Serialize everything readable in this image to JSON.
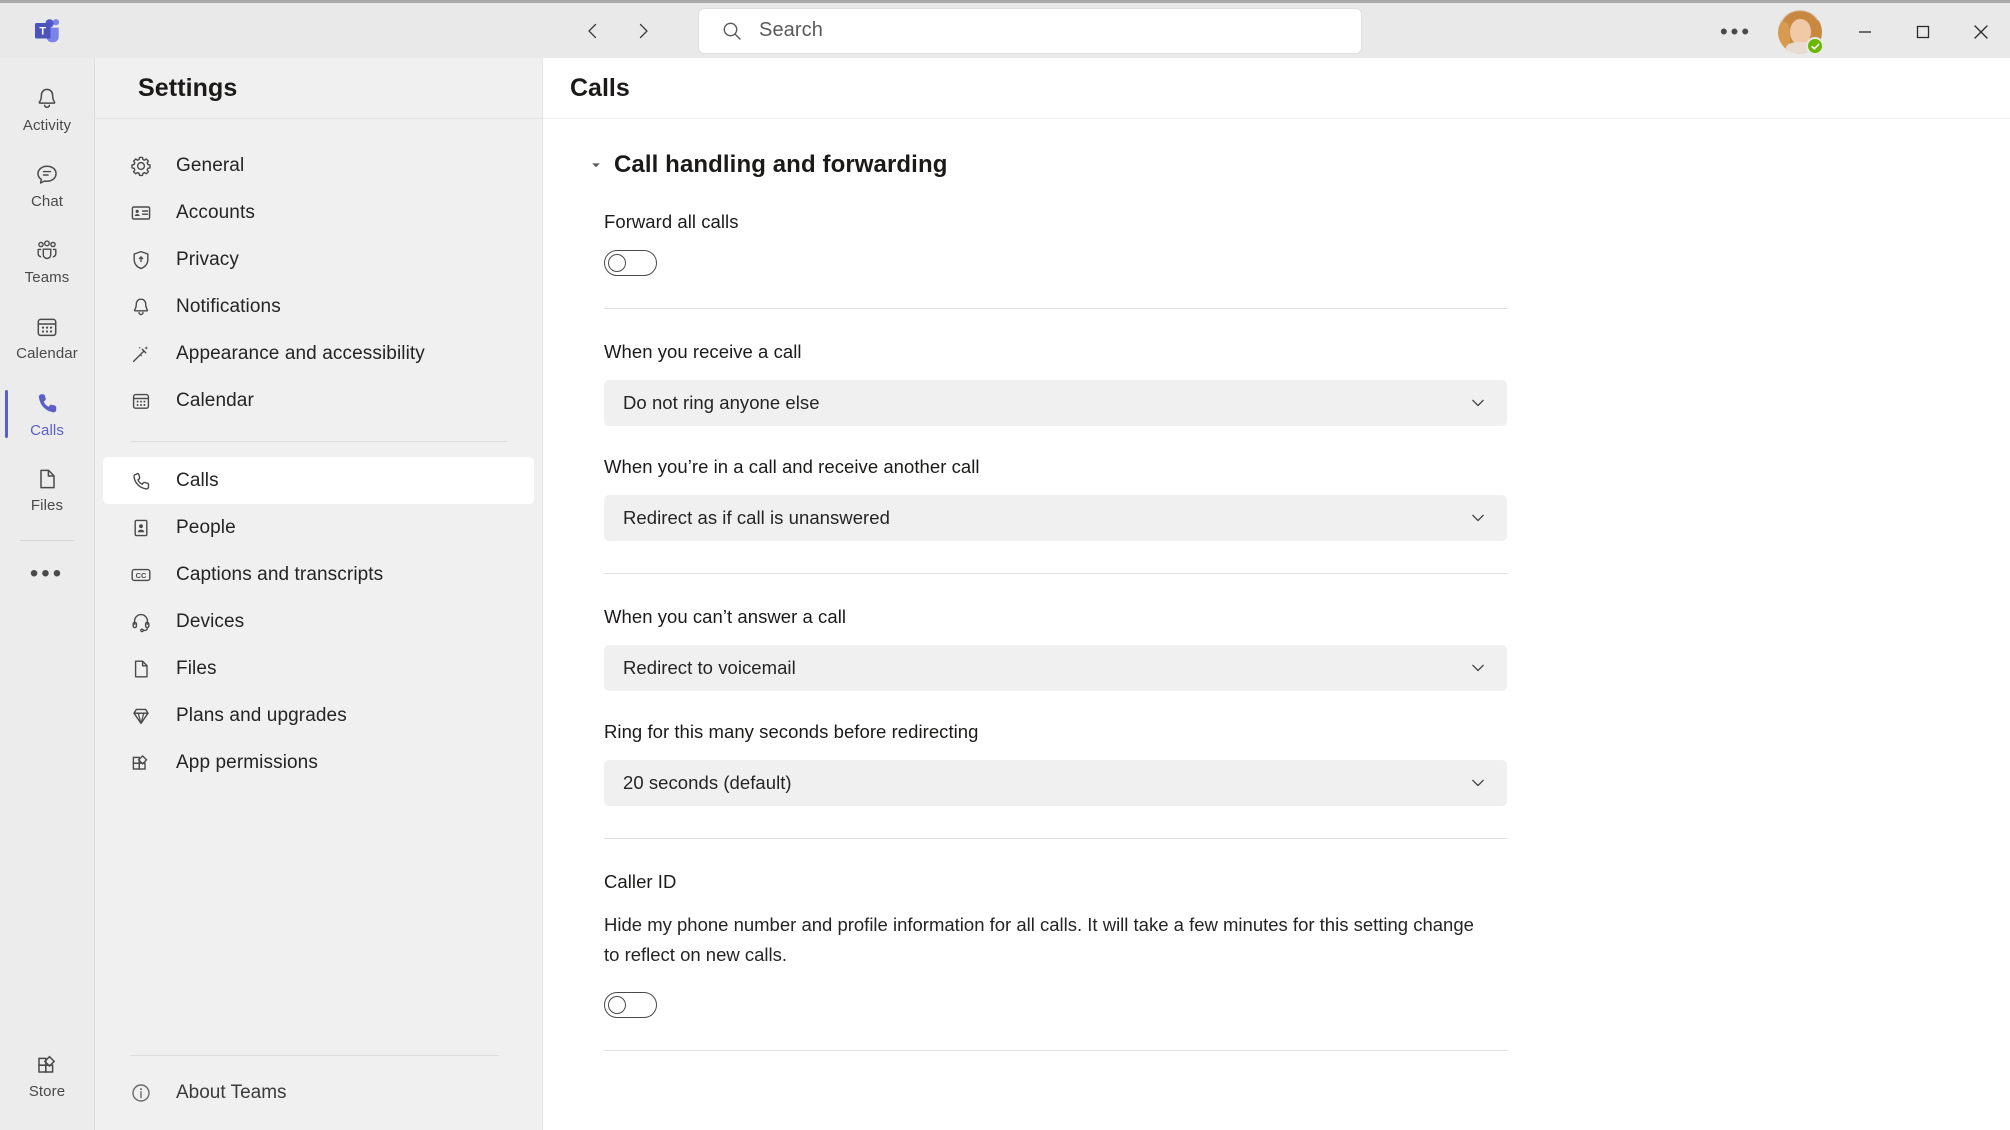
{
  "titlebar": {
    "logo_icon": "teams-logo-icon",
    "back_icon": "chevron-left-icon",
    "forward_icon": "chevron-right-icon",
    "search_placeholder": "Search",
    "search_value": "",
    "search_icon": "search-icon",
    "more_label": "•••",
    "avatar_name": "user-avatar",
    "presence_status": "available",
    "presence_color": "#6bb700",
    "minimize_icon": "minimize-icon",
    "maximize_icon": "maximize-icon",
    "close_icon": "close-icon"
  },
  "rail": {
    "items": [
      {
        "label": "Activity",
        "icon": "bell-icon",
        "active": false
      },
      {
        "label": "Chat",
        "icon": "chat-icon",
        "active": false
      },
      {
        "label": "Teams",
        "icon": "teams-people-icon",
        "active": false
      },
      {
        "label": "Calendar",
        "icon": "calendar-icon",
        "active": false
      },
      {
        "label": "Calls",
        "icon": "phone-icon",
        "active": true
      },
      {
        "label": "Files",
        "icon": "file-icon",
        "active": false
      }
    ],
    "more_label": "•••",
    "store": {
      "label": "Store",
      "icon": "store-icon"
    },
    "accent_color": "#5b5fc7"
  },
  "settings": {
    "title": "Settings",
    "items": [
      {
        "label": "General",
        "icon": "gear-icon",
        "selected": false
      },
      {
        "label": "Accounts",
        "icon": "id-card-icon",
        "selected": false
      },
      {
        "label": "Privacy",
        "icon": "shield-lock-icon",
        "selected": false
      },
      {
        "label": "Notifications",
        "icon": "bell-icon",
        "selected": false
      },
      {
        "label": "Appearance and accessibility",
        "icon": "magic-wand-icon",
        "selected": false
      },
      {
        "label": "Calendar",
        "icon": "calendar-icon",
        "selected": false
      }
    ],
    "items2": [
      {
        "label": "Calls",
        "icon": "phone-icon",
        "selected": true
      },
      {
        "label": "People",
        "icon": "person-card-icon",
        "selected": false
      },
      {
        "label": "Captions and transcripts",
        "icon": "closed-caption-icon",
        "selected": false
      },
      {
        "label": "Devices",
        "icon": "headset-icon",
        "selected": false
      },
      {
        "label": "Files",
        "icon": "file-icon",
        "selected": false
      },
      {
        "label": "Plans and upgrades",
        "icon": "diamond-icon",
        "selected": false
      },
      {
        "label": "App permissions",
        "icon": "apps-icon",
        "selected": false
      }
    ],
    "about": {
      "label": "About Teams",
      "icon": "info-icon"
    }
  },
  "main": {
    "title": "Calls",
    "section": {
      "title": "Call handling and forwarding",
      "expanded": true,
      "caret_icon": "caret-down-icon"
    },
    "forward_all_calls": {
      "label": "Forward all calls",
      "toggle_state": "off"
    },
    "fields": [
      {
        "label": "When you receive a call",
        "value": "Do not ring anyone else",
        "chevron_icon": "chevron-down-icon"
      },
      {
        "label": "When you’re in a call and receive another call",
        "value": "Redirect as if call is unanswered",
        "chevron_icon": "chevron-down-icon"
      }
    ],
    "fields2": [
      {
        "label": "When you can’t answer a call",
        "value": "Redirect to voicemail",
        "chevron_icon": "chevron-down-icon"
      },
      {
        "label": "Ring for this many seconds before redirecting",
        "value": "20 seconds (default)",
        "chevron_icon": "chevron-down-icon"
      }
    ],
    "caller_id": {
      "label": "Caller ID",
      "description": "Hide my phone number and profile information for all calls. It will take a few minutes for this setting change to reflect on new calls.",
      "toggle_state": "off"
    }
  }
}
